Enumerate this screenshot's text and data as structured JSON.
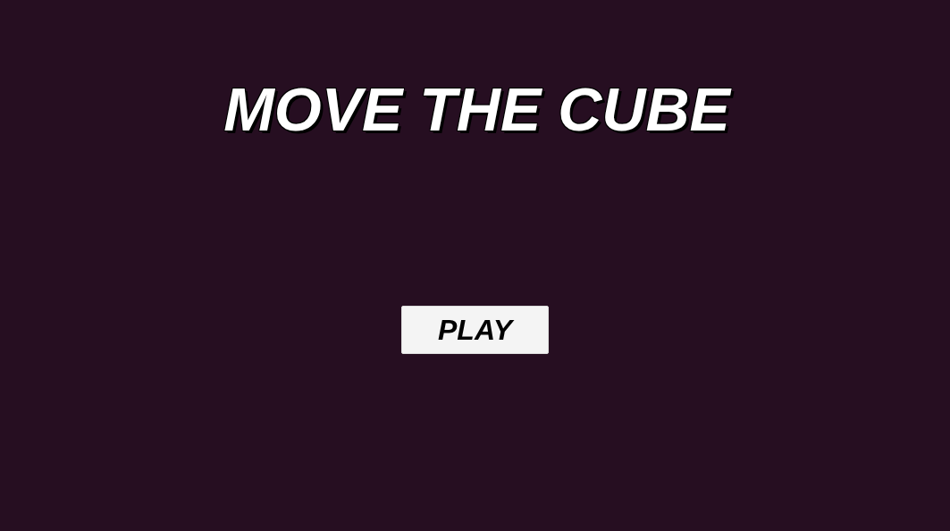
{
  "title": "MOVE THE CUBE",
  "buttons": [
    {
      "label": "PLAY"
    }
  ]
}
